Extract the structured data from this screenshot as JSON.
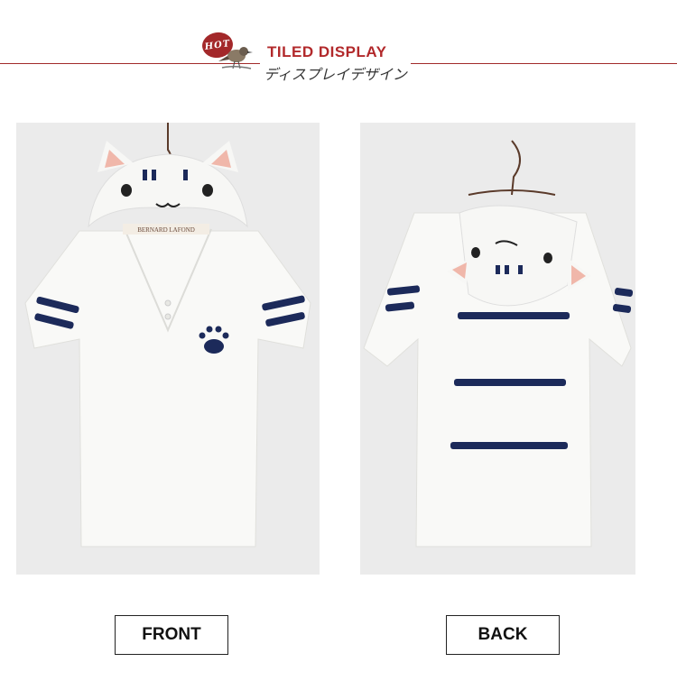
{
  "header": {
    "badge": "HOT",
    "title": "TILED DISPLAY",
    "subtitle": "ディスプレイデザイン"
  },
  "front": {
    "label": "FRONT",
    "tag_text": "BERNARD LAFOND"
  },
  "back": {
    "label": "BACK"
  },
  "colors": {
    "accent": "#a3282a",
    "stripe": "#1c2a5a",
    "ear": "#f2b8ad"
  }
}
